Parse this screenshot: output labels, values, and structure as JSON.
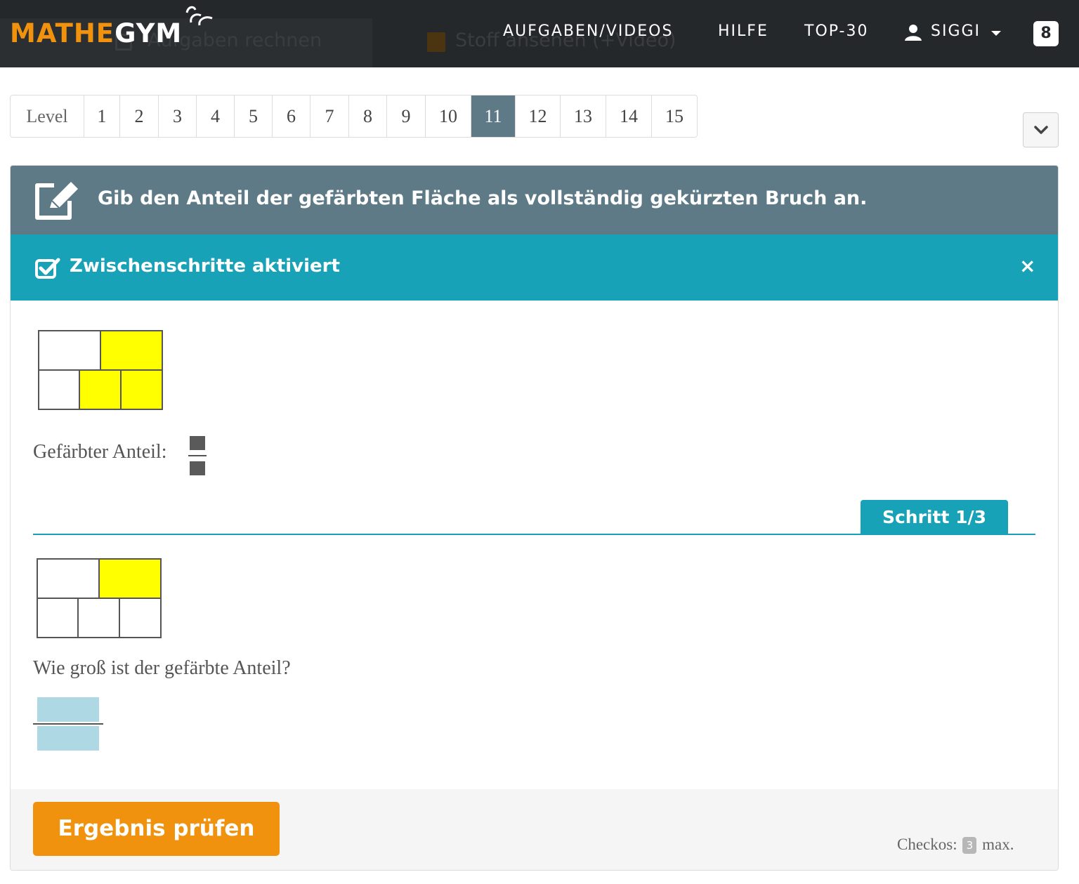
{
  "nav": {
    "logo_part1": "MATHE",
    "logo_part2": "GYM",
    "ghost_tab_1": "Aufgaben rechnen",
    "ghost_tab_2": "Stoff ansehen (+Video)",
    "links": [
      "AUFGABEN/VIDEOS",
      "HILFE",
      "TOP-30"
    ],
    "user": "SIGGI",
    "badge": "8",
    "colors": {
      "bar": "#25282b",
      "brand_orange": "#f0920d"
    }
  },
  "levels": {
    "label": "Level",
    "items": [
      "1",
      "2",
      "3",
      "4",
      "5",
      "6",
      "7",
      "8",
      "9",
      "10",
      "11",
      "12",
      "13",
      "14",
      "15"
    ],
    "active": "11"
  },
  "task": {
    "title": "Gib den Anteil der gefärbten Fläche als vollständig gekürzten Bruch an.",
    "steps_notice": "Zwischenschritte aktiviert",
    "close_icon": "×",
    "figure1_label": "Gefärbter Anteil:",
    "step_tab": "Schritt 1/3",
    "question": "Wie groß ist der gefärbte Anteil?",
    "colors": {
      "header": "#5d7a86",
      "steps": "#17a2b8",
      "fill": "#ffff00",
      "input": "#aed8e4"
    }
  },
  "footer": {
    "check_button": "Ergebnis prüfen",
    "checkos_label": "Checkos:",
    "checkos_value": "3",
    "checkos_suffix": "max."
  },
  "icons": [
    "edit-icon",
    "checkbox-checked-icon",
    "close-icon",
    "user-icon",
    "chevron-down-icon",
    "caret-down-icon"
  ]
}
